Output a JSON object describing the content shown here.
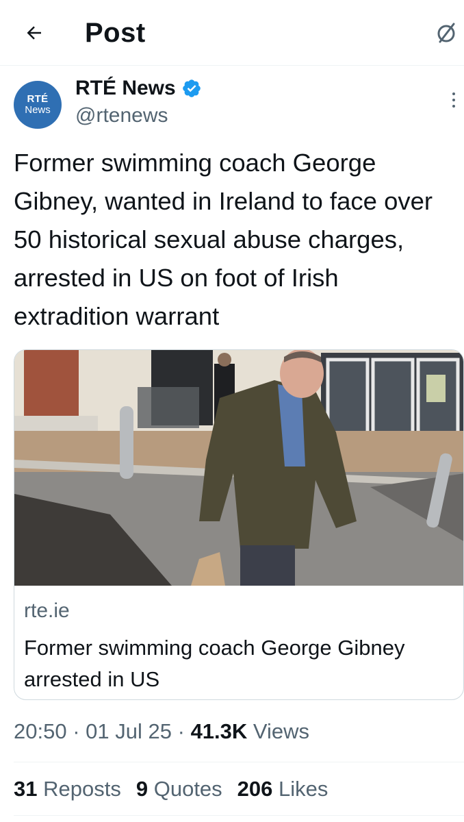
{
  "header": {
    "title": "Post",
    "back_icon": "arrow-left-icon",
    "grok_icon": "grok-icon"
  },
  "author": {
    "avatar_line1": "RTÉ",
    "avatar_line2": "News",
    "name": "RTÉ News",
    "handle": "@rtenews",
    "verified": true,
    "avatar_color": "#2f6fb3",
    "verified_color": "#1d9bf0"
  },
  "tweet": {
    "text": "Former swimming coach George Gibney, wanted in Ireland to face over 50 historical sexual abuse charges, arrested in US on foot of Irish extradition warrant"
  },
  "card": {
    "domain": "rte.ie",
    "title": "Former swimming coach George Gibney arrested in US"
  },
  "meta": {
    "time": "20:50",
    "sep1": "·",
    "date": "01 Jul 25",
    "sep2": "·",
    "views_count": "41.3K",
    "views_label": "Views"
  },
  "stats": {
    "reposts_count": "31",
    "reposts_label": "Reposts",
    "quotes_count": "9",
    "quotes_label": "Quotes",
    "likes_count": "206",
    "likes_label": "Likes"
  }
}
